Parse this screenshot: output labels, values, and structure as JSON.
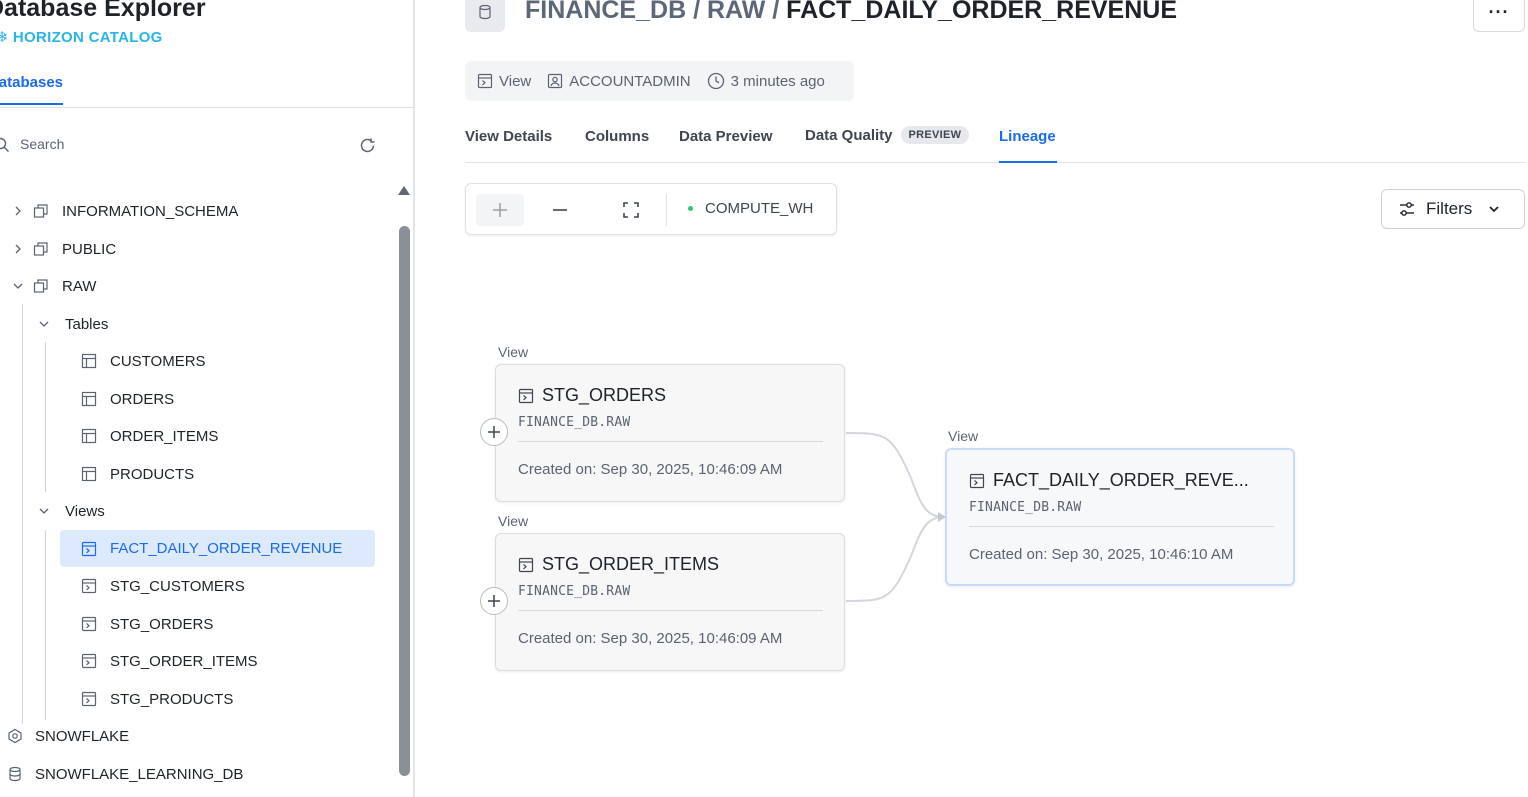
{
  "sidebar": {
    "app_title": "Database Explorer",
    "brand": "HORIZON CATALOG",
    "tab_label": "Databases",
    "search": {
      "placeholder": "Search"
    },
    "tree": {
      "schemas": [
        {
          "label": "INFORMATION_SCHEMA"
        },
        {
          "label": "PUBLIC"
        },
        {
          "label": "RAW"
        }
      ],
      "tables_group": "Tables",
      "tables": [
        "CUSTOMERS",
        "ORDERS",
        "ORDER_ITEMS",
        "PRODUCTS"
      ],
      "views_group": "Views",
      "views": [
        "FACT_DAILY_ORDER_REVENUE",
        "STG_CUSTOMERS",
        "STG_ORDERS",
        "STG_ORDER_ITEMS",
        "STG_PRODUCTS"
      ],
      "selected_view": "FACT_DAILY_ORDER_REVENUE",
      "databases": [
        "SNOWFLAKE",
        "SNOWFLAKE_LEARNING_DB"
      ]
    }
  },
  "header": {
    "breadcrumb_db": "FINANCE_DB",
    "breadcrumb_schema": "RAW",
    "breadcrumb_object": "FACT_DAILY_ORDER_REVENUE",
    "sep": "/",
    "more_label": "···"
  },
  "meta": {
    "type": "View",
    "owner": "ACCOUNTADMIN",
    "updated": "3 minutes ago"
  },
  "tabs": [
    {
      "label": "View Details"
    },
    {
      "label": "Columns"
    },
    {
      "label": "Data Preview"
    },
    {
      "label": "Data Quality",
      "badge": "PREVIEW"
    },
    {
      "label": "Lineage"
    }
  ],
  "active_tab": "Lineage",
  "toolbar": {
    "warehouse": "COMPUTE_WH",
    "filters_label": "Filters"
  },
  "lineage": {
    "nodes": [
      {
        "kind": "View",
        "name": "STG_ORDERS",
        "schema": "FINANCE_DB.RAW",
        "created": "Created on: Sep 30, 2025, 10:46:09 AM"
      },
      {
        "kind": "View",
        "name": "STG_ORDER_ITEMS",
        "schema": "FINANCE_DB.RAW",
        "created": "Created on: Sep 30, 2025, 10:46:09 AM"
      },
      {
        "kind": "View",
        "name": "FACT_DAILY_ORDER_REVE...",
        "schema": "FINANCE_DB.RAW",
        "created": "Created on: Sep 30, 2025, 10:46:10 AM"
      }
    ]
  },
  "colors": {
    "accent": "#1a6ce7",
    "brand": "#29b5e8",
    "selected_bg": "#dde9fc",
    "warehouse_status": "#2ec27e"
  }
}
